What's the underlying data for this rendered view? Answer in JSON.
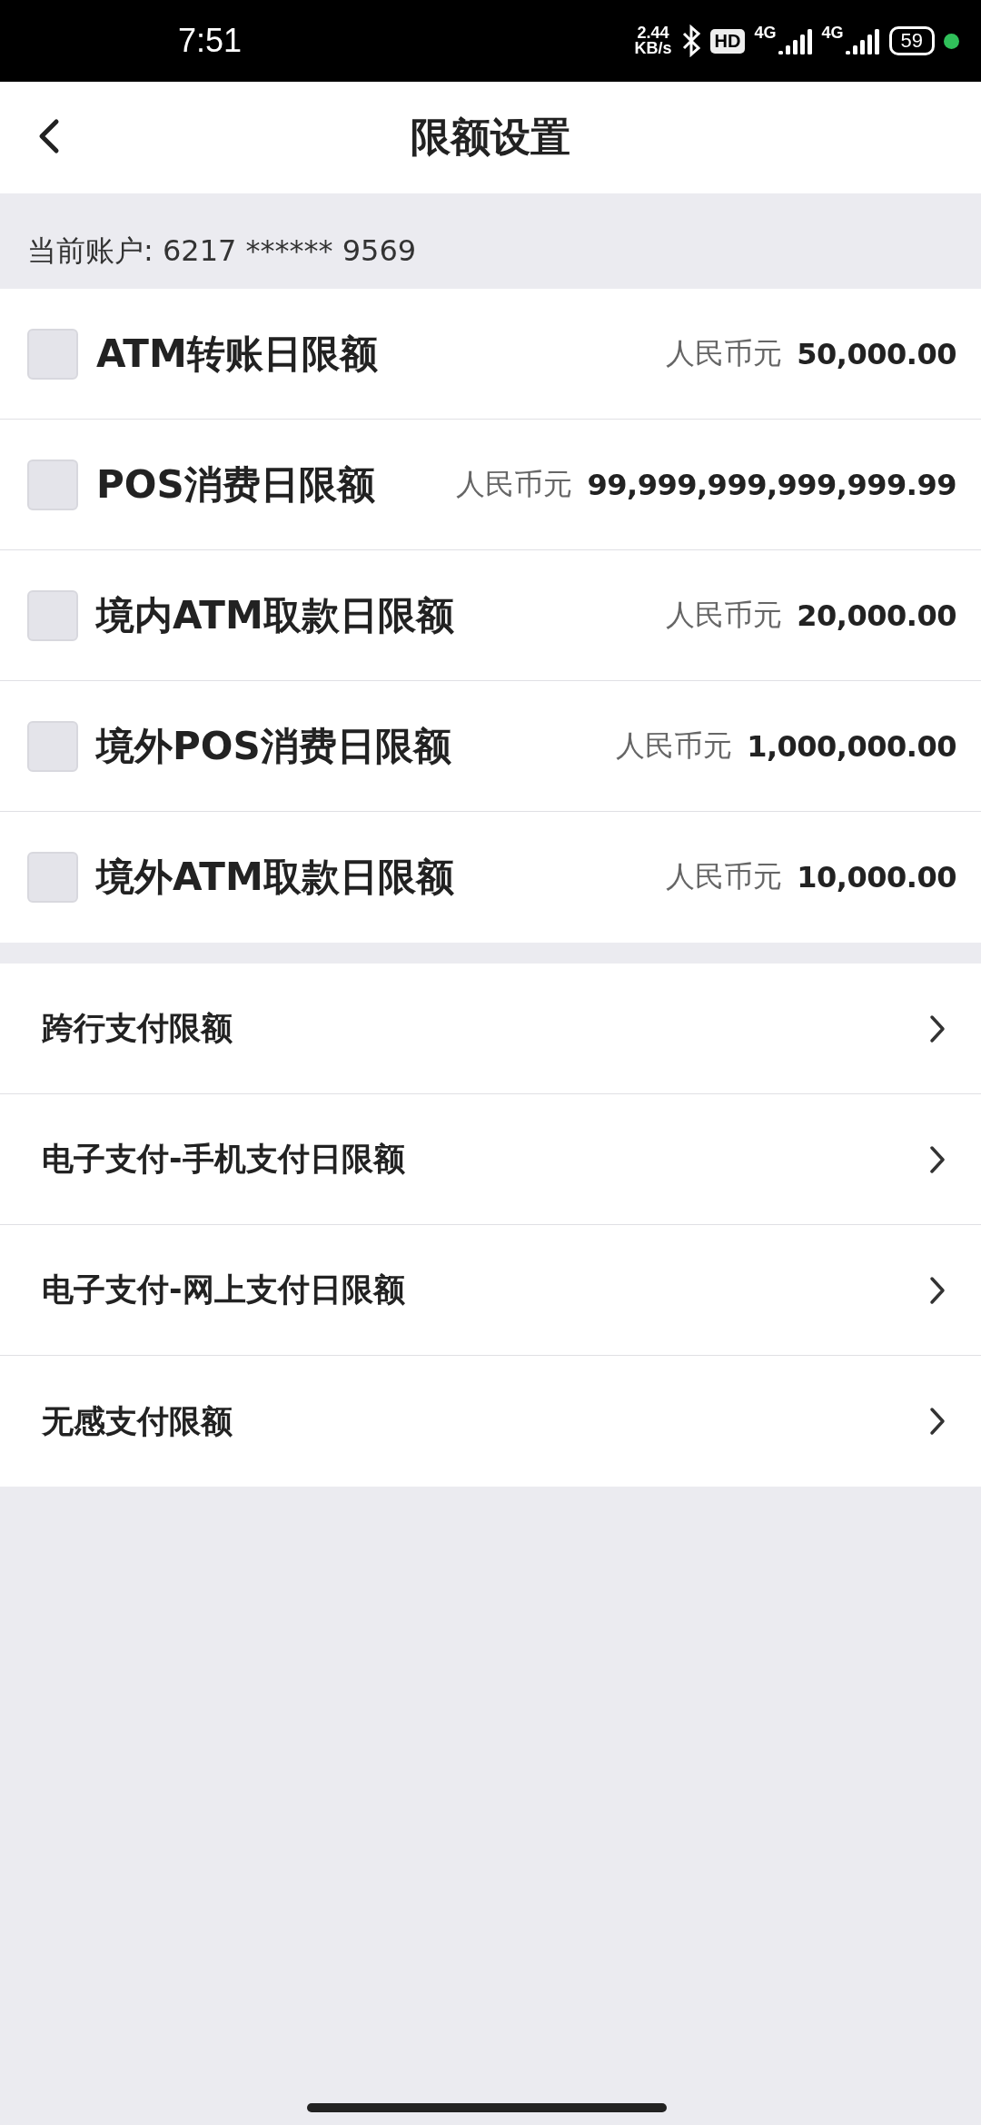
{
  "status_bar": {
    "time": "7:51",
    "net_speed": "2.44",
    "net_unit": "KB/s",
    "hd": "HD",
    "sim1": "4G",
    "sim2": "4G",
    "battery": "59"
  },
  "header": {
    "title": "限额设置"
  },
  "account": {
    "label": "当前账户: 6217 ****** 9569"
  },
  "limits": [
    {
      "name": "ATM转账日限额",
      "currency": "人民币元",
      "amount": "50,000.00",
      "checked": false
    },
    {
      "name": "POS消费日限额",
      "currency": "人民币元",
      "amount": "99,999,999,999,999.99",
      "checked": false
    },
    {
      "name": "境内ATM取款日限额",
      "currency": "人民币元",
      "amount": "20,000.00",
      "checked": false
    },
    {
      "name": "境外POS消费日限额",
      "currency": "人民币元",
      "amount": "1,000,000.00",
      "checked": false
    },
    {
      "name": "境外ATM取款日限额",
      "currency": "人民币元",
      "amount": "10,000.00",
      "checked": false
    }
  ],
  "links": [
    {
      "label": "跨行支付限额"
    },
    {
      "label": "电子支付-手机支付日限额"
    },
    {
      "label": "电子支付-网上支付日限额"
    },
    {
      "label": "无感支付限额"
    }
  ]
}
